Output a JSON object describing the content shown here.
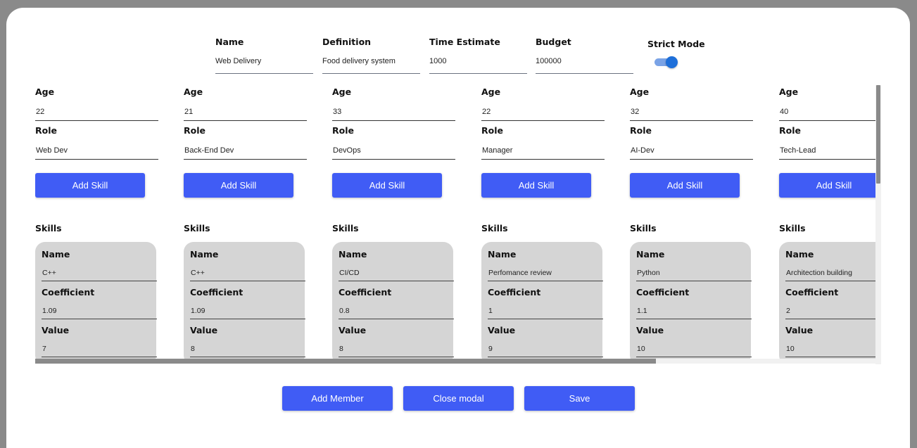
{
  "project": {
    "name_label": "Name",
    "name_value": "Web Delivery",
    "definition_label": "Definition",
    "definition_value": "Food delivery system",
    "time_label": "Time Estimate",
    "time_value": "1000",
    "budget_label": "Budget",
    "budget_value": "100000",
    "strict_label": "Strict Mode",
    "strict_on": true
  },
  "labels": {
    "age": "Age",
    "role": "Role",
    "add_skill": "Add Skill",
    "skills": "Skills",
    "skill_name": "Name",
    "coefficient": "Coefficient",
    "value": "Value"
  },
  "members": [
    {
      "age": "22",
      "role": "Web Dev",
      "skill": {
        "name": "C++",
        "coefficient": "1.09",
        "value": "7"
      }
    },
    {
      "age": "21",
      "role": "Back-End Dev",
      "skill": {
        "name": "C++",
        "coefficient": "1.09",
        "value": "8"
      }
    },
    {
      "age": "33",
      "role": "DevOps",
      "skill": {
        "name": "CI/CD",
        "coefficient": "0.8",
        "value": "8"
      }
    },
    {
      "age": "22",
      "role": "Manager",
      "skill": {
        "name": "Perfomance review",
        "coefficient": "1",
        "value": "9"
      }
    },
    {
      "age": "32",
      "role": "AI-Dev",
      "skill": {
        "name": "Python",
        "coefficient": "1.1",
        "value": "10"
      }
    },
    {
      "age": "40",
      "role": "Tech-Lead",
      "skill": {
        "name": "Architection building",
        "coefficient": "2",
        "value": "10"
      }
    }
  ],
  "footer": {
    "add_member": "Add Member",
    "close_modal": "Close modal",
    "save": "Save"
  },
  "colors": {
    "accent": "#405cf5",
    "card": "#d5d5d5",
    "toggle_knob": "#1e6fd9"
  }
}
